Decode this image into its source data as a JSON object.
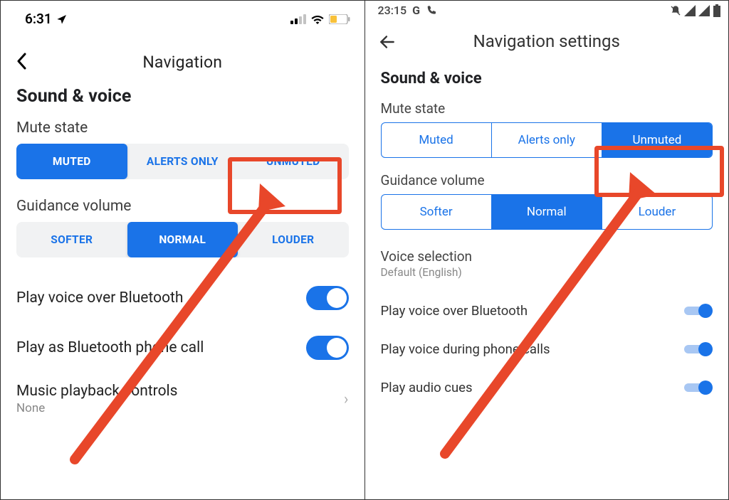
{
  "ios": {
    "status": {
      "time": "6:31"
    },
    "header": {
      "title": "Navigation"
    },
    "section": "Sound & voice",
    "mute_label": "Mute state",
    "mute_opts": [
      "MUTED",
      "ALERTS ONLY",
      "UNMUTED"
    ],
    "volume_label": "Guidance volume",
    "volume_opts": [
      "SOFTER",
      "NORMAL",
      "LOUDER"
    ],
    "row_bt": "Play voice over Bluetooth",
    "row_btcall": "Play as Bluetooth phone call",
    "music_row": {
      "primary": "Music playback controls",
      "secondary": "None"
    }
  },
  "android": {
    "status": {
      "time": "23:15"
    },
    "header": {
      "title": "Navigation settings"
    },
    "section": "Sound & voice",
    "mute_label": "Mute state",
    "mute_opts": [
      "Muted",
      "Alerts only",
      "Unmuted"
    ],
    "volume_label": "Guidance volume",
    "volume_opts": [
      "Softer",
      "Normal",
      "Louder"
    ],
    "voice_selection": {
      "primary": "Voice selection",
      "secondary": "Default (English)"
    },
    "row_bt": "Play voice over Bluetooth",
    "row_call": "Play voice during phone calls",
    "row_cues": "Play audio cues"
  },
  "annotation": {
    "accent": "#1a73e8",
    "highlight": "#e8472a"
  }
}
